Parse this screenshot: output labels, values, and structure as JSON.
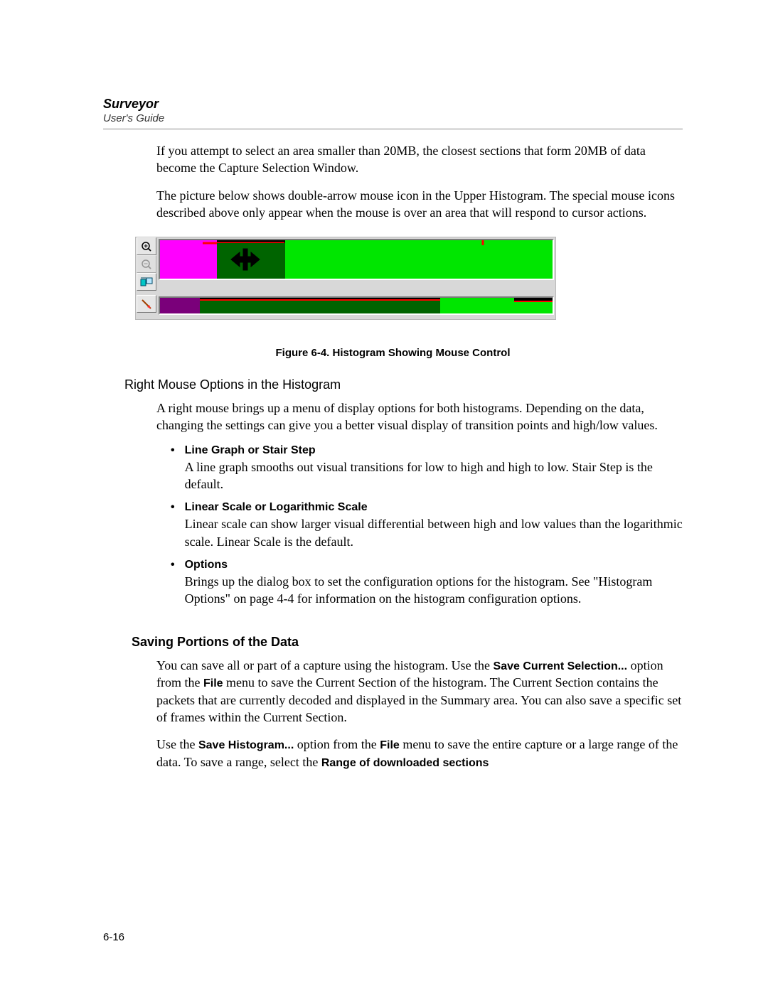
{
  "header": {
    "title": "Surveyor",
    "subtitle": "User's Guide"
  },
  "para_intro_1": "If you attempt to select an area smaller than 20MB, the closest sections that form 20MB of data become the Capture Selection Window.",
  "para_intro_2": "The picture below shows double-arrow mouse icon in the Upper Histogram. The special mouse icons described above only appear when the mouse is over an area that will respond to cursor actions.",
  "figure_caption": "Figure 6-4.  Histogram Showing Mouse Control",
  "section_sub": "Right Mouse Options in the Histogram",
  "para_rightmouse": "A right mouse brings up a menu of display options for both histograms. Depending on the data, changing the settings can give you a better visual display of transition points and high/low values.",
  "bullets": {
    "b1_title": "Line Graph or Stair Step",
    "b1_body": "A line graph smooths out visual transitions for low to high and high to low. Stair Step is the default.",
    "b2_title": "Linear Scale or Logarithmic Scale",
    "b2_body": "Linear scale can show larger visual differential between high and low values than the logarithmic scale. Linear Scale is the default.",
    "b3_title": "Options",
    "b3_body": "Brings up the dialog box to set the configuration options for the histogram. See \"Histogram Options\" on page 4-4 for information on the histogram configuration options."
  },
  "section_main": "Saving Portions of the Data",
  "saving": {
    "p1_pre": "You can save all or part of a capture using the histogram. Use the ",
    "p1_b1": "Save Current Selection...",
    "p1_mid1": " option from the ",
    "p1_b2": "File",
    "p1_post": " menu to save the Current Section of the histogram. The Current Section contains the packets that are currently decoded and displayed in the Summary area. You can also save a specific set of frames within the Current Section.",
    "p2_pre": "Use the ",
    "p2_b1": "Save Histogram...",
    "p2_mid1": " option from the ",
    "p2_b2": "File",
    "p2_mid2": " menu to save the entire capture or a large range of the data. To save a range, select the ",
    "p2_b3": "Range of downloaded sections"
  },
  "page_number": "6-16",
  "icons": {
    "zoom_in": "zoom-in-icon",
    "zoom_out": "zoom-out-icon",
    "fit": "fit-window-icon",
    "pointer": "pointer-tool-icon"
  }
}
